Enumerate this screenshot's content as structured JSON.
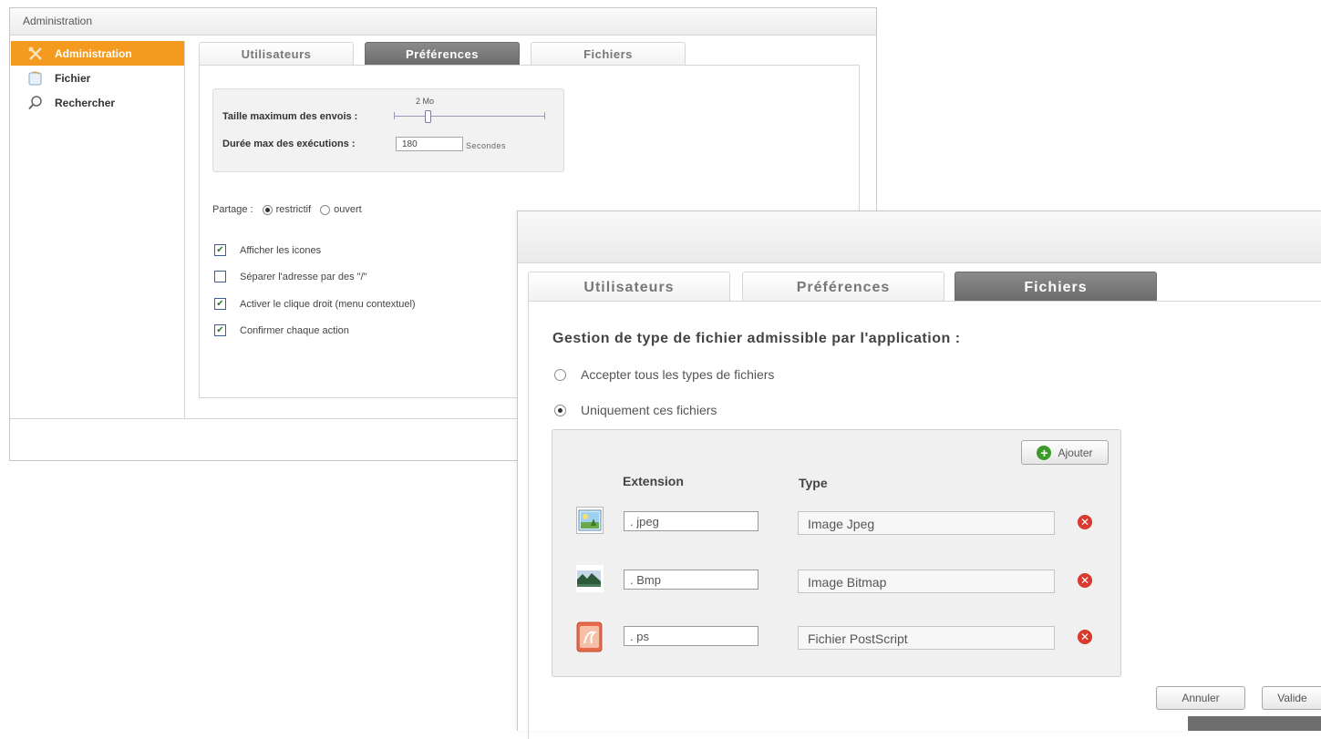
{
  "back_window": {
    "title": "Administration",
    "sidebar": [
      {
        "label": "Administration",
        "icon": "tools-icon",
        "active": true
      },
      {
        "label": "Fichier",
        "icon": "file-icon",
        "active": false
      },
      {
        "label": "Rechercher",
        "icon": "magnifier-icon",
        "active": false
      }
    ],
    "tabs": [
      "Utilisateurs",
      "Préférences",
      "Fichiers"
    ],
    "active_tab": "Préférences",
    "max_upload_label": "Taille maximum des envois :",
    "max_upload_value": "2 Mo",
    "max_exec_label": "Durée max des exécutions :",
    "max_exec_value": "180",
    "max_exec_unit": "Secondes",
    "share_label": "Partage :",
    "share_options": [
      "restrictif",
      "ouvert"
    ],
    "share_selected": "restrictif",
    "checkboxes": [
      {
        "label": "Afficher les icones",
        "checked": true
      },
      {
        "label": "Séparer l'adresse par des \"/\"",
        "checked": false
      },
      {
        "label": "Activer le clique droit (menu contextuel)",
        "checked": true
      },
      {
        "label": "Confirmer chaque action",
        "checked": true
      }
    ]
  },
  "front_window": {
    "tabs": [
      "Utilisateurs",
      "Préférences",
      "Fichiers"
    ],
    "active_tab": "Fichiers",
    "heading": "Gestion de type de fichier admissible par l'application :",
    "radio_options": [
      "Accepter tous les types de fichiers",
      "Uniquement ces fichiers"
    ],
    "radio_selected": "Uniquement ces fichiers",
    "add_button": "Ajouter",
    "col_extension": "Extension",
    "col_type": "Type",
    "files": [
      {
        "extension": ". jpeg",
        "type": "Image Jpeg",
        "icon": "image-icon"
      },
      {
        "extension": ". Bmp",
        "type": "Image Bitmap",
        "icon": "landscape-icon"
      },
      {
        "extension": ". ps",
        "type": "Fichier PostScript",
        "icon": "postscript-icon"
      }
    ],
    "cancel_button": "Annuler",
    "validate_button": "Valide"
  },
  "colors": {
    "accent_orange": "#f39a1f",
    "tab_selected": "#6c6c6c",
    "delete_red": "#d83a2e",
    "add_green": "#3b9a2a"
  }
}
